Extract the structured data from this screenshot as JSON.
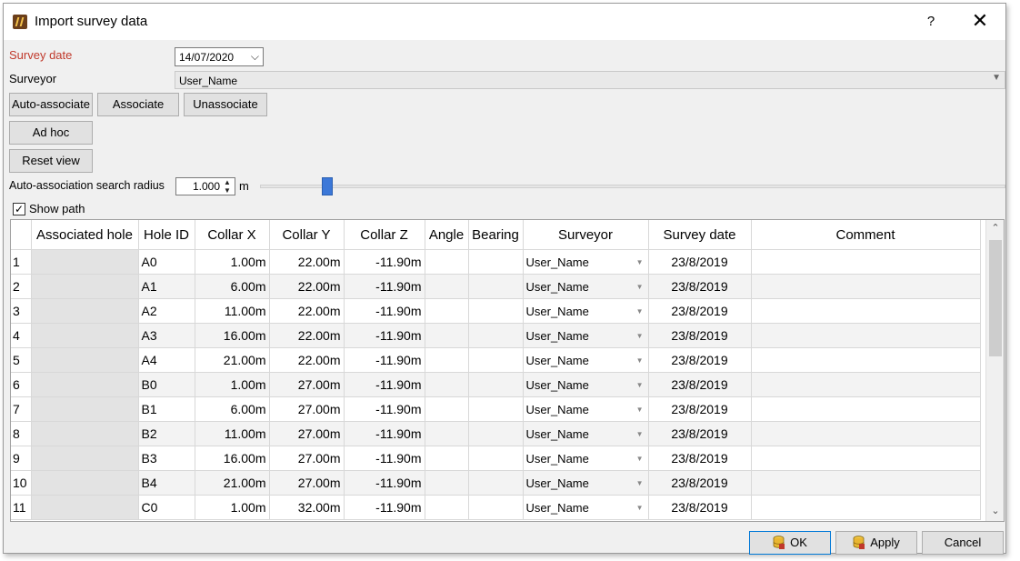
{
  "window": {
    "title": "Import survey data",
    "help": "?",
    "close": "✕"
  },
  "form": {
    "survey_date_label": "Survey date",
    "survey_date_value": "14/07/2020",
    "surveyor_label": "Surveyor",
    "surveyor_value": "User_Name",
    "buttons": {
      "auto_associate": "Auto-associate",
      "associate": "Associate",
      "unassociate": "Unassociate",
      "ad_hoc": "Ad hoc",
      "reset_view": "Reset view"
    },
    "radius_label": "Auto-association search radius",
    "radius_value": "1.000",
    "radius_unit": "m",
    "radius_slider_level": 0.09,
    "show_path_label": "Show path",
    "show_path_checked": true
  },
  "table": {
    "columns": [
      "",
      "Associated hole",
      "Hole ID",
      "Collar X",
      "Collar Y",
      "Collar Z",
      "Angle",
      "Bearing",
      "Surveyor",
      "Survey date",
      "Comment"
    ],
    "rows": [
      {
        "n": "1",
        "assoc": "",
        "id": "A0",
        "x": "1.00m",
        "y": "22.00m",
        "z": "-11.90m",
        "angle": "",
        "bearing": "",
        "surveyor": "User_Name",
        "date": "23/8/2019",
        "comment": ""
      },
      {
        "n": "2",
        "assoc": "",
        "id": "A1",
        "x": "6.00m",
        "y": "22.00m",
        "z": "-11.90m",
        "angle": "",
        "bearing": "",
        "surveyor": "User_Name",
        "date": "23/8/2019",
        "comment": ""
      },
      {
        "n": "3",
        "assoc": "",
        "id": "A2",
        "x": "11.00m",
        "y": "22.00m",
        "z": "-11.90m",
        "angle": "",
        "bearing": "",
        "surveyor": "User_Name",
        "date": "23/8/2019",
        "comment": ""
      },
      {
        "n": "4",
        "assoc": "",
        "id": "A3",
        "x": "16.00m",
        "y": "22.00m",
        "z": "-11.90m",
        "angle": "",
        "bearing": "",
        "surveyor": "User_Name",
        "date": "23/8/2019",
        "comment": ""
      },
      {
        "n": "5",
        "assoc": "",
        "id": "A4",
        "x": "21.00m",
        "y": "22.00m",
        "z": "-11.90m",
        "angle": "",
        "bearing": "",
        "surveyor": "User_Name",
        "date": "23/8/2019",
        "comment": ""
      },
      {
        "n": "6",
        "assoc": "",
        "id": "B0",
        "x": "1.00m",
        "y": "27.00m",
        "z": "-11.90m",
        "angle": "",
        "bearing": "",
        "surveyor": "User_Name",
        "date": "23/8/2019",
        "comment": ""
      },
      {
        "n": "7",
        "assoc": "",
        "id": "B1",
        "x": "6.00m",
        "y": "27.00m",
        "z": "-11.90m",
        "angle": "",
        "bearing": "",
        "surveyor": "User_Name",
        "date": "23/8/2019",
        "comment": ""
      },
      {
        "n": "8",
        "assoc": "",
        "id": "B2",
        "x": "11.00m",
        "y": "27.00m",
        "z": "-11.90m",
        "angle": "",
        "bearing": "",
        "surveyor": "User_Name",
        "date": "23/8/2019",
        "comment": ""
      },
      {
        "n": "9",
        "assoc": "",
        "id": "B3",
        "x": "16.00m",
        "y": "27.00m",
        "z": "-11.90m",
        "angle": "",
        "bearing": "",
        "surveyor": "User_Name",
        "date": "23/8/2019",
        "comment": ""
      },
      {
        "n": "10",
        "assoc": "",
        "id": "B4",
        "x": "21.00m",
        "y": "27.00m",
        "z": "-11.90m",
        "angle": "",
        "bearing": "",
        "surveyor": "User_Name",
        "date": "23/8/2019",
        "comment": ""
      },
      {
        "n": "11",
        "assoc": "",
        "id": "C0",
        "x": "1.00m",
        "y": "32.00m",
        "z": "-11.90m",
        "angle": "",
        "bearing": "",
        "surveyor": "User_Name",
        "date": "23/8/2019",
        "comment": ""
      }
    ]
  },
  "footer": {
    "ok": "OK",
    "apply": "Apply",
    "cancel": "Cancel"
  },
  "icons": {
    "app": "app-logo-icon",
    "close": "close-icon",
    "help": "help-icon",
    "dropdown": "chevron-down-icon",
    "spin": "spin-arrows-icon",
    "ok": "database-icon",
    "apply": "database-icon",
    "scroll_up": "chevron-up-icon",
    "scroll_down": "chevron-down-icon"
  },
  "colors": {
    "accent": "#3c78d8",
    "label_red": "#c0392b",
    "default_button_border": "#0078d7"
  }
}
